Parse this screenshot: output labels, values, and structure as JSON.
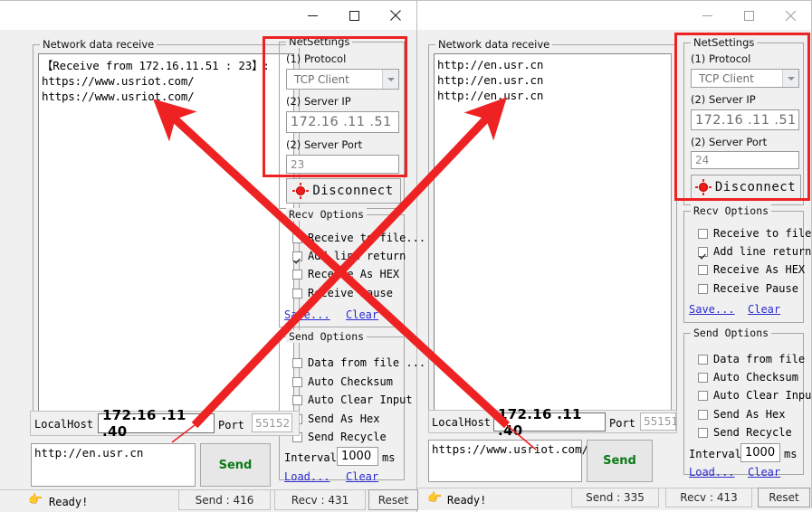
{
  "windows": [
    {
      "id": "left",
      "active": true,
      "titlebar": {
        "minimize": "minimize-icon",
        "maximize": "maximize-icon",
        "close": "close-icon"
      },
      "receive": {
        "group_title": "Network data receive",
        "lines": [
          "【Receive from 172.16.11.51 : 23】:",
          "https://www.usriot.com/",
          "https://www.usriot.com/"
        ]
      },
      "net_settings": {
        "group_title": "NetSettings",
        "protocol_label": "(1) Protocol",
        "protocol_value": "TCP Client",
        "server_ip_label": "(2) Server IP",
        "server_ip_value": "172.16 .11 .51",
        "server_port_label": "(2) Server Port",
        "server_port_value": "23",
        "connect_button": "Disconnect"
      },
      "recv_options": {
        "group_title": "Recv Options",
        "items": [
          {
            "label": "Receive to file...",
            "checked": false
          },
          {
            "label": "Add line return",
            "checked": true
          },
          {
            "label": "Receive As HEX",
            "checked": false
          },
          {
            "label": "Receive Pause",
            "checked": false
          }
        ],
        "save_link": "Save...",
        "clear_link": "Clear"
      },
      "send_options": {
        "group_title": "Send Options",
        "items": [
          {
            "label": "Data from file ...",
            "checked": false
          },
          {
            "label": "Auto Checksum",
            "checked": false
          },
          {
            "label": "Auto Clear Input",
            "checked": false
          },
          {
            "label": "Send As Hex",
            "checked": false
          },
          {
            "label": "Send Recycle",
            "checked": false
          }
        ],
        "interval_label": "Interval",
        "interval_value": "1000",
        "interval_unit": "ms",
        "load_link": "Load...",
        "clear_link": "Clear"
      },
      "host_bar": {
        "localhost_label": "LocalHost",
        "localhost_value": "172.16 .11 .40",
        "port_label": "Port",
        "port_value": "55152"
      },
      "send_area": {
        "text": "http://en.usr.cn",
        "send_button": "Send"
      },
      "status_bar": {
        "ready_text": "Ready!",
        "send_count": "Send : 416",
        "recv_count": "Recv : 431",
        "reset_button": "Reset"
      }
    },
    {
      "id": "right",
      "active": false,
      "titlebar": {
        "minimize": "minimize-icon",
        "maximize": "maximize-icon",
        "close": "close-icon"
      },
      "receive": {
        "group_title": "Network data receive",
        "lines": [
          "http://en.usr.cn",
          "http://en.usr.cn",
          "http://en.usr.cn"
        ]
      },
      "net_settings": {
        "group_title": "NetSettings",
        "protocol_label": "(1) Protocol",
        "protocol_value": "TCP Client",
        "server_ip_label": "(2) Server IP",
        "server_ip_value": "172.16 .11 .51",
        "server_port_label": "(2) Server Port",
        "server_port_value": "24",
        "connect_button": "Disconnect"
      },
      "recv_options": {
        "group_title": "Recv Options",
        "items": [
          {
            "label": "Receive to file...",
            "checked": false
          },
          {
            "label": "Add line return",
            "checked": true
          },
          {
            "label": "Receive As HEX",
            "checked": false
          },
          {
            "label": "Receive Pause",
            "checked": false
          }
        ],
        "save_link": "Save...",
        "clear_link": "Clear"
      },
      "send_options": {
        "group_title": "Send Options",
        "items": [
          {
            "label": "Data from file ...",
            "checked": false
          },
          {
            "label": "Auto Checksum",
            "checked": false
          },
          {
            "label": "Auto Clear Input",
            "checked": false
          },
          {
            "label": "Send As Hex",
            "checked": false
          },
          {
            "label": "Send Recycle",
            "checked": false
          }
        ],
        "interval_label": "Interval",
        "interval_value": "1000",
        "interval_unit": "ms",
        "load_link": "Load...",
        "clear_link": "Clear"
      },
      "host_bar": {
        "localhost_label": "LocalHost",
        "localhost_value": "172.16 .11 .40",
        "port_label": "Port",
        "port_value": "55151"
      },
      "send_area": {
        "text": "https://www.usriot.com/",
        "send_button": "Send"
      },
      "status_bar": {
        "ready_text": "Ready!",
        "send_count": "Send : 335",
        "recv_count": "Recv : 413",
        "reset_button": "Reset"
      }
    }
  ],
  "background_window": {
    "reset_button_partial": "et"
  },
  "annotations": {
    "accent_color": "#ee2222",
    "highlight_boxes": 2,
    "arrows": 2
  }
}
